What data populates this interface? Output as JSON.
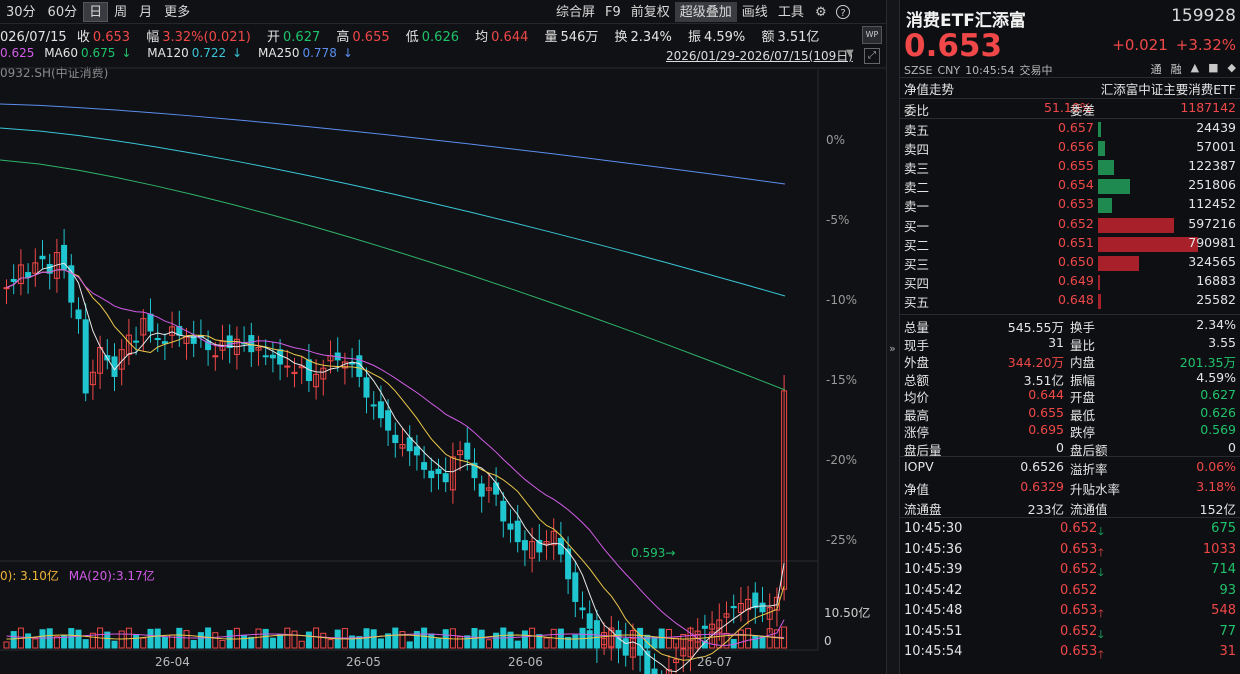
{
  "toolbar": {
    "left": [
      "30分",
      "60分",
      "日",
      "周",
      "月",
      "更多"
    ],
    "right": [
      "综合屏",
      "F9",
      "前复权",
      "超级叠加",
      "画线",
      "工具"
    ],
    "gear_icon": "gear-icon",
    "help_icon": "help-icon"
  },
  "infoline": {
    "date": "026/07/15",
    "close_label": "收",
    "close": "0.653",
    "amp_label": "幅",
    "amp": "3.32%(0.021)",
    "open_label": "开",
    "open": "0.627",
    "high_label": "高",
    "high": "0.655",
    "low_label": "低",
    "low": "0.626",
    "avg_label": "均",
    "avg": "0.644",
    "vol_label": "量",
    "vol": "546万",
    "turn_label": "换",
    "turn": "2.34%",
    "swing_label": "振",
    "swing": "4.59%",
    "amount_label": "额",
    "amount": "3.51亿"
  },
  "maline": {
    "ma_partial": "0.625",
    "ma60_label": "MA60",
    "ma60": "0.675",
    "ma120_label": "MA120",
    "ma120": "0.722",
    "ma250_label": "MA250",
    "ma250": "0.778"
  },
  "daterange": "2026/01/29-2026/07/15(109日)",
  "wp_label": "WP",
  "index_name": "0932.SH(中证消费)",
  "pct_labels": [
    "0%",
    "-5%",
    "-10%",
    "-15%",
    "-20%",
    "-25%"
  ],
  "low_marker": "0.593",
  "vol_ma": {
    "ma5": "0): 3.10亿",
    "ma20_label": "MA(20):",
    "ma20": "3.17亿"
  },
  "vol_labels": [
    "10.50亿",
    "0"
  ],
  "x_labels": [
    "26-04",
    "26-05",
    "26-06",
    "26-07"
  ],
  "panel": {
    "name": "消费ETF汇添富",
    "code": "159928",
    "price": "0.653",
    "change": "+0.021",
    "change_pct": "+3.32%",
    "meta": [
      "SZSE",
      "CNY",
      "10:45:54",
      "交易中"
    ],
    "flags": [
      "通",
      "融",
      "▲",
      "■",
      "◆"
    ],
    "nav_label": "净值走势",
    "nav_name": "汇添富中证主要消费ETF",
    "weibi_label": "委比",
    "weibi": "51.10%",
    "weicha_label": "委差",
    "weicha": "1187142",
    "asks": [
      {
        "label": "卖五",
        "price": "0.657",
        "vol": "24439",
        "pct": 0.031
      },
      {
        "label": "卖四",
        "price": "0.656",
        "vol": "57001",
        "pct": 0.072
      },
      {
        "label": "卖三",
        "price": "0.655",
        "vol": "122387",
        "pct": 0.155
      },
      {
        "label": "卖二",
        "price": "0.654",
        "vol": "251806",
        "pct": 0.318
      },
      {
        "label": "卖一",
        "price": "0.653",
        "vol": "112452",
        "pct": 0.142
      }
    ],
    "bids": [
      {
        "label": "买一",
        "price": "0.652",
        "vol": "597216",
        "pct": 0.755
      },
      {
        "label": "买二",
        "price": "0.651",
        "vol": "790981",
        "pct": 1.0
      },
      {
        "label": "买三",
        "price": "0.650",
        "vol": "324565",
        "pct": 0.41
      },
      {
        "label": "买四",
        "price": "0.649",
        "vol": "16883",
        "pct": 0.021
      },
      {
        "label": "买五",
        "price": "0.648",
        "vol": "25582",
        "pct": 0.032
      }
    ],
    "stats": [
      {
        "l1": "总量",
        "v1": "545.55万",
        "c1": "white",
        "l2": "换手",
        "v2": "2.34%",
        "c2": "white"
      },
      {
        "l1": "现手",
        "v1": "31",
        "c1": "white",
        "l2": "量比",
        "v2": "3.55",
        "c2": "white"
      },
      {
        "l1": "外盘",
        "v1": "344.20万",
        "c1": "red",
        "l2": "内盘",
        "v2": "201.35万",
        "c2": "green"
      },
      {
        "l1": "总额",
        "v1": "3.51亿",
        "c1": "white",
        "l2": "振幅",
        "v2": "4.59%",
        "c2": "white"
      },
      {
        "l1": "均价",
        "v1": "0.644",
        "c1": "red",
        "l2": "开盘",
        "v2": "0.627",
        "c2": "green"
      },
      {
        "l1": "最高",
        "v1": "0.655",
        "c1": "red",
        "l2": "最低",
        "v2": "0.626",
        "c2": "green"
      },
      {
        "l1": "涨停",
        "v1": "0.695",
        "c1": "red",
        "l2": "跌停",
        "v2": "0.569",
        "c2": "green"
      },
      {
        "l1": "盘后量",
        "v1": "0",
        "c1": "white",
        "l2": "盘后额",
        "v2": "0",
        "c2": "white"
      }
    ],
    "stats2": [
      {
        "l1": "IOPV",
        "v1": "0.6526",
        "c1": "white",
        "l2": "溢折率",
        "v2": "0.06%",
        "c2": "red"
      },
      {
        "l1": "净值",
        "v1": "0.6329",
        "c1": "red",
        "l2": "升贴水率",
        "v2": "3.18%",
        "c2": "red"
      },
      {
        "l1": "流通盘",
        "v1": "233亿",
        "c1": "white",
        "l2": "流通值",
        "v2": "152亿",
        "c2": "white"
      }
    ],
    "ticks": [
      {
        "time": "10:45:30",
        "price": "0.652",
        "dir": "down",
        "vol": "675"
      },
      {
        "time": "10:45:36",
        "price": "0.653",
        "dir": "up",
        "vol": "1033"
      },
      {
        "time": "10:45:39",
        "price": "0.652",
        "dir": "down",
        "vol": "714"
      },
      {
        "time": "10:45:42",
        "price": "0.652",
        "dir": "none",
        "vol": "93"
      },
      {
        "time": "10:45:48",
        "price": "0.653",
        "dir": "up",
        "vol": "548"
      },
      {
        "time": "10:45:51",
        "price": "0.652",
        "dir": "down",
        "vol": "77"
      },
      {
        "time": "10:45:54",
        "price": "0.653",
        "dir": "up",
        "vol": "31"
      }
    ]
  },
  "colors": {
    "up": "#f04848",
    "down": "#1fc6d0",
    "ma5": "#e8e8e8",
    "ma10": "#ecc94b",
    "ma20": "#d25ce8",
    "ma60": "#2fb36a",
    "ma120": "#39c6d6",
    "ma250": "#5b8ef0",
    "bid_bar": "#a8202a",
    "ask_bar": "#1e8a50"
  },
  "chart_data": {
    "type": "candlestick",
    "closes": [
      0.703,
      0.706,
      0.714,
      0.708,
      0.715,
      0.717,
      0.71,
      0.72,
      0.712,
      0.696,
      0.688,
      0.652,
      0.662,
      0.674,
      0.668,
      0.66,
      0.673,
      0.68,
      0.677,
      0.688,
      0.682,
      0.678,
      0.676,
      0.684,
      0.68,
      0.679,
      0.676,
      0.679,
      0.673,
      0.67,
      0.677,
      0.674,
      0.678,
      0.676,
      0.672,
      0.674,
      0.67,
      0.669,
      0.666,
      0.665,
      0.662,
      0.665,
      0.658,
      0.661,
      0.664,
      0.67,
      0.668,
      0.667,
      0.666,
      0.66,
      0.65,
      0.646,
      0.64,
      0.634,
      0.628,
      0.627,
      0.624,
      0.622,
      0.615,
      0.611,
      0.613,
      0.609,
      0.621,
      0.624,
      0.62,
      0.611,
      0.602,
      0.606,
      0.603,
      0.59,
      0.586,
      0.58,
      0.576,
      0.58,
      0.575,
      0.58,
      0.585,
      0.574,
      0.562,
      0.551,
      0.547,
      0.538,
      0.529,
      0.533,
      0.537,
      0.529,
      0.525,
      0.533,
      0.525,
      0.515,
      0.516,
      0.513,
      0.518,
      0.523,
      0.528,
      0.532,
      0.535,
      0.538,
      0.54,
      0.542,
      0.545,
      0.548,
      0.55,
      0.552,
      0.548,
      0.546,
      0.548,
      0.553,
      0.653
    ],
    "low_value": 0.593
  }
}
